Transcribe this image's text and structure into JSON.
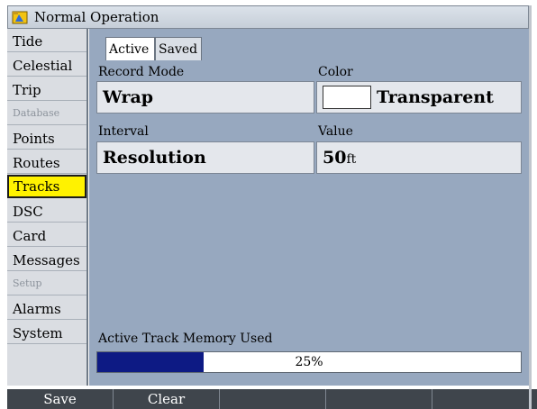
{
  "window": {
    "title": "Normal Operation",
    "icon": "folder-icon"
  },
  "sidebar": {
    "items": [
      {
        "label": "Tide",
        "type": "item"
      },
      {
        "label": "Celestial",
        "type": "item"
      },
      {
        "label": "Trip",
        "type": "item"
      },
      {
        "label": "Database",
        "type": "section"
      },
      {
        "label": "Points",
        "type": "item"
      },
      {
        "label": "Routes",
        "type": "item"
      },
      {
        "label": "Tracks",
        "type": "item",
        "selected": true
      },
      {
        "label": "DSC",
        "type": "item"
      },
      {
        "label": "Card",
        "type": "item"
      },
      {
        "label": "Messages",
        "type": "item"
      },
      {
        "label": "Setup",
        "type": "section"
      },
      {
        "label": "Alarms",
        "type": "item"
      },
      {
        "label": "System",
        "type": "item"
      }
    ]
  },
  "tabs": [
    {
      "label": "Active",
      "active": true
    },
    {
      "label": "Saved",
      "active": false
    }
  ],
  "fields": {
    "record_mode": {
      "label": "Record Mode",
      "value": "Wrap"
    },
    "color": {
      "label": "Color",
      "value": "Transparent",
      "swatch": "#ffffff"
    },
    "interval": {
      "label": "Interval",
      "value": "Resolution"
    },
    "value": {
      "label": "Value",
      "number": "50",
      "unit": "ft"
    }
  },
  "memory": {
    "label": "Active Track Memory Used",
    "percent_text": "25%",
    "fraction": 0.25,
    "fill_color": "#0d1a84"
  },
  "softkeys": [
    {
      "label": "Save"
    },
    {
      "label": "Clear"
    },
    {
      "label": ""
    },
    {
      "label": ""
    },
    {
      "label": ""
    }
  ]
}
